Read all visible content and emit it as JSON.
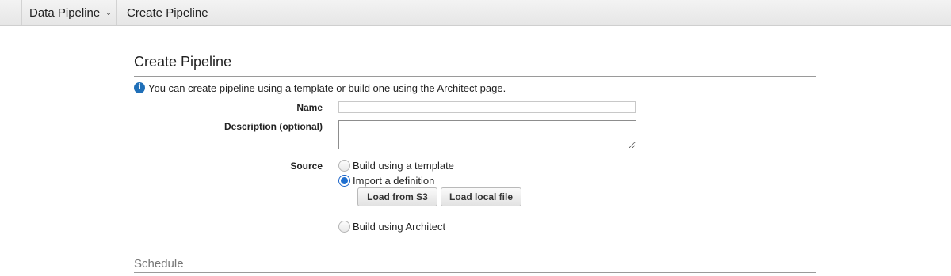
{
  "topbar": {
    "service_label": "Data Pipeline",
    "service_chevron": "⌄",
    "breadcrumb": "Create Pipeline"
  },
  "page": {
    "title": "Create Pipeline",
    "info_icon": "info-circle-icon",
    "info_text": "You can create pipeline using a template or build one using the Architect page."
  },
  "form": {
    "name": {
      "label": "Name",
      "value": "",
      "placeholder": ""
    },
    "description": {
      "label": "Description (optional)",
      "value": "",
      "placeholder": ""
    },
    "source": {
      "label": "Source",
      "options": [
        {
          "label": "Build using a template",
          "checked": false
        },
        {
          "label": "Import a definition",
          "checked": true
        },
        {
          "label": "Build using Architect",
          "checked": false
        }
      ],
      "buttons": {
        "load_s3": "Load from S3",
        "load_local": "Load local file"
      }
    }
  },
  "schedule": {
    "title": "Schedule"
  },
  "colors": {
    "accent": "#1f6fd0",
    "info_icon": "#1f6fb8",
    "topbar": "#ececec"
  }
}
